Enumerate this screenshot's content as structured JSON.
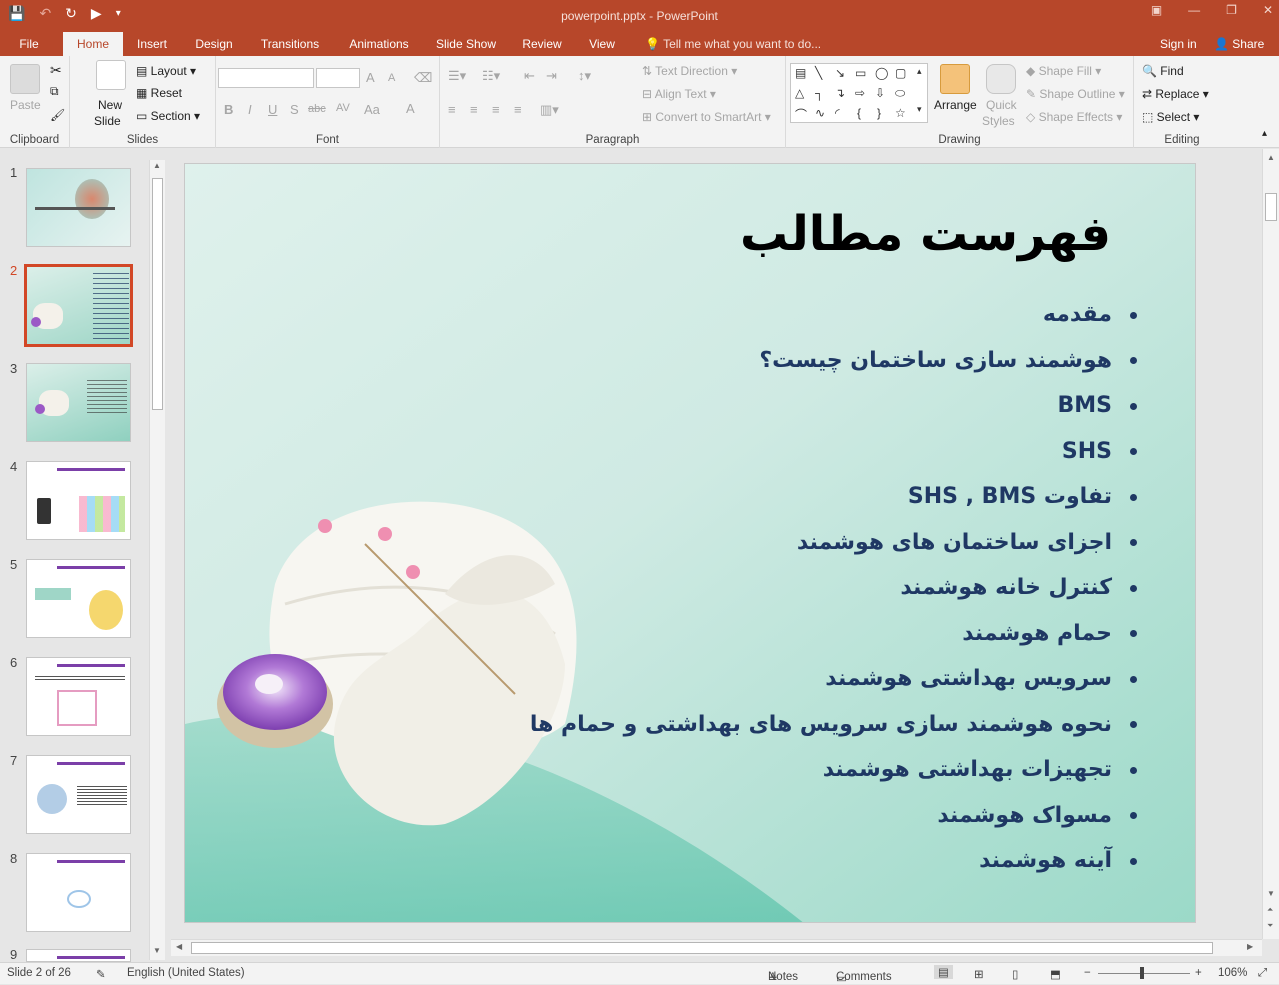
{
  "window": {
    "title": "powerpoint.pptx - PowerPoint"
  },
  "qat": {
    "save": "💾",
    "undo": "↶",
    "redo": "↻",
    "present": "▶",
    "more": "▾"
  },
  "tabs": [
    "File",
    "Home",
    "Insert",
    "Design",
    "Transitions",
    "Animations",
    "Slide Show",
    "Review",
    "View"
  ],
  "active_tab": "Home",
  "tell_me": "Tell me what you want to do...",
  "account": {
    "sign_in": "Sign in",
    "share": "Share"
  },
  "ribbon": {
    "clipboard": {
      "label": "Clipboard",
      "paste": "Paste"
    },
    "slides": {
      "label": "Slides",
      "new_slide": "New",
      "new_slide2": "Slide",
      "layout": "Layout",
      "reset": "Reset",
      "section": "Section"
    },
    "font": {
      "label": "Font",
      "bold": "B",
      "italic": "I",
      "underline": "U",
      "shadow": "S",
      "strike": "abc",
      "spacing": "AV",
      "case": "Aa",
      "color": "A",
      "grow": "A",
      "shrink": "A"
    },
    "paragraph": {
      "label": "Paragraph",
      "text_direction": "Text Direction",
      "align_text": "Align Text",
      "smartart": "Convert to SmartArt"
    },
    "drawing": {
      "label": "Drawing",
      "arrange": "Arrange",
      "quick_styles": "Quick",
      "quick_styles2": "Styles",
      "shape_fill": "Shape Fill",
      "shape_outline": "Shape Outline",
      "shape_effects": "Shape Effects"
    },
    "editing": {
      "label": "Editing",
      "find": "Find",
      "replace": "Replace",
      "select": "Select"
    }
  },
  "thumbnails": [
    "1",
    "2",
    "3",
    "4",
    "5",
    "6",
    "7",
    "8",
    "9"
  ],
  "selected_slide": 2,
  "slide": {
    "title": "فهرست مطالب",
    "bullets": [
      "مقدمه",
      "هوشمند سازی ساختمان چیست؟",
      "BMS",
      "SHS",
      "تفاوت  SHS , BMS",
      "اجزای ساختمان های هوشمند",
      "کنترل خانه هوشمند",
      "حمام هوشمند",
      "سرویس بهداشتی هوشمند",
      "نحوه هوشمند سازی سرویس های بهداشتی و حمام ها",
      "تجهیزات بهداشتی هوشمند",
      "مسواک هوشمند",
      "آینه هوشمند"
    ]
  },
  "status": {
    "slide_info": "Slide 2 of 26",
    "language": "English (United States)",
    "notes": "Notes",
    "comments": "Comments",
    "zoom": "106%"
  },
  "colors": {
    "accent": "#b7472a",
    "bullet_text": "#1f3864",
    "selection": "#d24726"
  }
}
